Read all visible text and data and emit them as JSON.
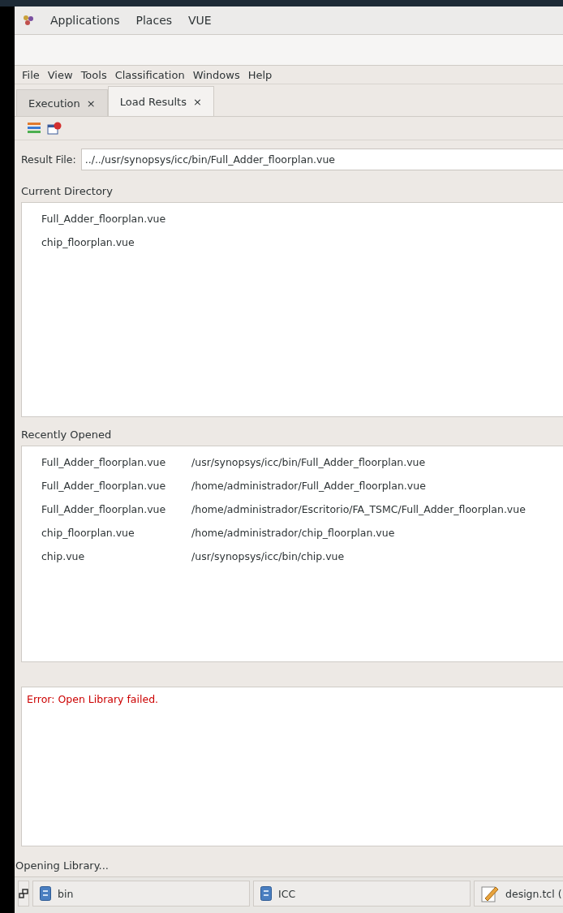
{
  "top_panel": {
    "items": [
      "Applications",
      "Places",
      "VUE"
    ]
  },
  "menu": [
    "File",
    "View",
    "Tools",
    "Classification",
    "Windows",
    "Help"
  ],
  "tabs": [
    {
      "label": "Execution",
      "close": "×",
      "selected": false
    },
    {
      "label": "Load Results",
      "close": "×",
      "selected": true
    }
  ],
  "result_file": {
    "label": "Result File:",
    "value": "../../usr/synopsys/icc/bin/Full_Adder_floorplan.vue"
  },
  "current_directory": {
    "title": "Current Directory",
    "files": [
      "Full_Adder_floorplan.vue",
      "chip_floorplan.vue"
    ]
  },
  "recently_opened": {
    "title": "Recently Opened",
    "rows": [
      {
        "name": "Full_Adder_floorplan.vue",
        "path": "/usr/synopsys/icc/bin/Full_Adder_floorplan.vue"
      },
      {
        "name": "Full_Adder_floorplan.vue",
        "path": "/home/administrador/Full_Adder_floorplan.vue"
      },
      {
        "name": "Full_Adder_floorplan.vue",
        "path": "/home/administrador/Escritorio/FA_TSMC/Full_Adder_floorplan.vue"
      },
      {
        "name": "chip_floorplan.vue",
        "path": "/home/administrador/chip_floorplan.vue"
      },
      {
        "name": "chip.vue",
        "path": "/usr/synopsys/icc/bin/chip.vue"
      }
    ]
  },
  "log": {
    "messages": [
      {
        "kind": "error",
        "text": "Error: Open Library failed."
      }
    ]
  },
  "status_bar": "Opening Library...",
  "taskbar": [
    {
      "kind": "folder",
      "label": "bin"
    },
    {
      "kind": "folder",
      "label": "ICC"
    },
    {
      "kind": "editor",
      "label": "design.tcl ("
    }
  ]
}
